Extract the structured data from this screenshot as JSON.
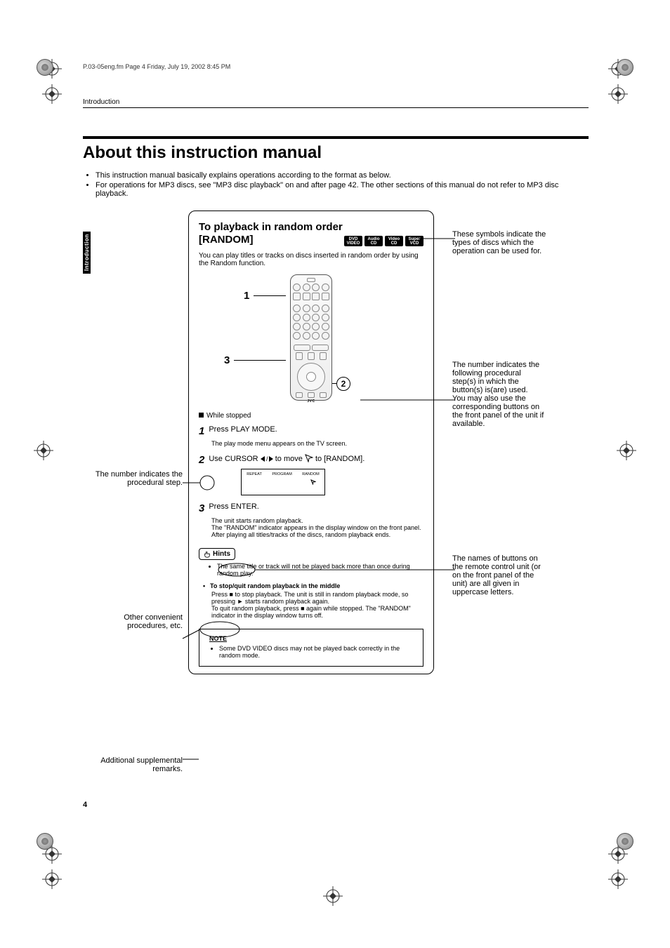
{
  "meta": {
    "fm_line": "P.03-05eng.fm  Page 4  Friday, July 19, 2002  8:45 PM"
  },
  "header": {
    "section": "Introduction"
  },
  "title": "About this instruction manual",
  "intro_bullets": [
    "This instruction manual basically explains operations according to the format as below.",
    "For operations for MP3 discs, see \"MP3 disc playback\" on and after page 42. The other sections of this manual do not refer to MP3 disc playback."
  ],
  "side_tab": "Introduction",
  "page_number": "4",
  "left_callouts": {
    "step_number": "The number indicates the procedural step.",
    "other": "Other convenient procedures, etc.",
    "remarks": "Additional supplemental remarks."
  },
  "right_callouts": {
    "symbols": "These symbols indicate the types of discs which the operation can be used for.",
    "remote_nums": "The number indicates the following procedural step(s) in which the button(s) is(are) used.\nYou may also use the corresponding buttons on the front panel of the unit if available.",
    "button_names": "The names of buttons on the remote control unit (or on the front panel of the unit) are all given in uppercase letters."
  },
  "panel": {
    "title_line1": "To playback in random order",
    "title_line2": "[RANDOM]",
    "disc_types": [
      {
        "line1": "DVD",
        "line2": "VIDEO"
      },
      {
        "line1": "Audio",
        "line2": "CD"
      },
      {
        "line1": "Video",
        "line2": "CD"
      },
      {
        "line1": "Super",
        "line2": "VCD"
      }
    ],
    "intro": "You can play titles or tracks on discs inserted in random order by using the Random function.",
    "remote_steps": [
      "1",
      "3"
    ],
    "remote_circle": "2",
    "remote_brand": "JVC",
    "while_stopped": "While stopped",
    "steps": [
      {
        "n": "1",
        "cmd": "Press PLAY MODE.",
        "sub": "The play mode menu appears on the TV screen."
      },
      {
        "n": "2",
        "cmd_a": "Use CURSOR ",
        "cmd_b": " to move ",
        "cmd_c": " to [RANDOM].",
        "menu": [
          "REPEAT",
          "PROGRAM",
          "RANDOM"
        ]
      },
      {
        "n": "3",
        "cmd": "Press ENTER.",
        "sub": "The unit starts random playback.\nThe \"RANDOM\" indicator appears in the display window on the front panel. After playing all titles/tracks of the discs, random playback ends."
      }
    ],
    "hints_label": "Hints",
    "hints_bullet": "The same title or track will not be played back more than once during random play.",
    "stop_heading": "To stop/quit random playback in the middle",
    "stop_body": "Press ■ to stop playback. The unit is still in random playback mode, so pressing ► starts random playback again.\nTo quit random playback, press ■ again while stopped. The \"RANDOM\" indicator in the display window turns off.",
    "note_title": "NOTE",
    "note_body": "Some DVD VIDEO discs may not be played back correctly in the random mode."
  }
}
